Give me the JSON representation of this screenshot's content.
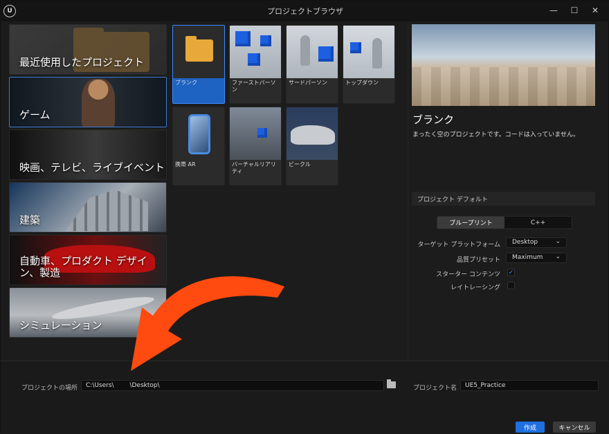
{
  "window": {
    "title": "プロジェクトブラウザ",
    "logo_text": "U",
    "controls": {
      "minimize": "—",
      "maximize": "☐",
      "close": "✕"
    }
  },
  "categories": [
    {
      "label": "最近使用したプロジェクト",
      "selected": false
    },
    {
      "label": "ゲーム",
      "selected": true
    },
    {
      "label": "映画、テレビ、ライブイベント",
      "selected": false
    },
    {
      "label": "建築",
      "selected": false
    },
    {
      "label": "自動車、プロダクト デザイン、製造",
      "selected": false
    },
    {
      "label": "シミュレーション",
      "selected": false
    }
  ],
  "templates": [
    {
      "label": "ブランク",
      "selected": true
    },
    {
      "label": "ファーストパーソン"
    },
    {
      "label": "サードパーソン"
    },
    {
      "label": "トップダウン"
    },
    {
      "label": "携帯 AR"
    },
    {
      "label": "バーチャルリアリティ"
    },
    {
      "label": "ビークル"
    }
  ],
  "preview": {
    "title": "ブランク",
    "description": "まったく空のプロジェクトです。コードは入っていません。"
  },
  "defaults": {
    "header": "プロジェクト デフォルト",
    "toggle": {
      "blueprint": "ブループリント",
      "cpp": "C++",
      "selected": "blueprint"
    },
    "target_platform": {
      "label": "ターゲット プラットフォーム",
      "value": "Desktop"
    },
    "quality_preset": {
      "label": "品質プリセット",
      "value": "Maximum"
    },
    "starter_content": {
      "label": "スターター コンテンツ",
      "checked": true
    },
    "raytracing": {
      "label": "レイトレーシング",
      "checked": false
    }
  },
  "bottom": {
    "location_label": "プロジェクトの場所",
    "location_value": "C:\\Users\\        \\Desktop\\",
    "name_label": "プロジェクト名",
    "name_value": "UE5_Practice",
    "create": "作成",
    "cancel": "キャンセル"
  },
  "colors": {
    "accent": "#1f6fe0",
    "arrow": "#ff4a10"
  }
}
